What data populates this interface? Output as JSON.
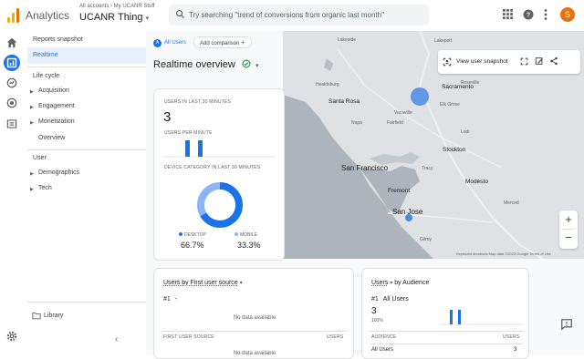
{
  "app": {
    "name": "Analytics"
  },
  "account": {
    "breadcrumb": "All accounts › My UCANR Stuff",
    "property": "UCANR Thing"
  },
  "search": {
    "placeholder": "Try searching \"trend of conversions from organic last month\""
  },
  "user": {
    "initial": "S"
  },
  "colors": {
    "accent": "#1a73e8",
    "avatar": "#e8710a",
    "logo_dark": "#e37400",
    "logo_light": "#f9ab00"
  },
  "nav": {
    "reports_snapshot": "Reports snapshot",
    "realtime": "Realtime",
    "life_cycle": "Life cycle",
    "acquisition": "Acquisition",
    "engagement": "Engagement",
    "monetization": "Monetization",
    "overview": "Overview",
    "user": "User",
    "demographics": "Demographics",
    "tech": "Tech",
    "library": "Library"
  },
  "toolbar": {
    "all_users": "All Users",
    "all_users_badge": "A",
    "add_comparison": "Add comparison"
  },
  "page": {
    "title": "Realtime overview"
  },
  "map": {
    "view_snapshot": "View user snapshot",
    "zoom_in": "+",
    "zoom_out": "−",
    "attribution": "Keyboard shortcuts   Map data ©2023 Google   Terms of Use",
    "cities": {
      "sacramento": "Sacramento",
      "santa_rosa": "Santa Rosa",
      "san_francisco": "San Francisco",
      "san_jose": "San Jose",
      "stockton": "Stockton",
      "modesto": "Modesto",
      "fremont": "Fremont",
      "vacaville": "Vacaville",
      "elk_grove": "Elk Grove",
      "healdsburg": "Healdsburg",
      "fairfield": "Fairfield",
      "napa": "Napa",
      "lodi": "Lodi",
      "roseville": "Roseville",
      "lakeport": "Lakeport",
      "lakeside": "Lakeside",
      "gilroy": "Gilroy",
      "tracy": "Tracy",
      "merced": "Merced"
    }
  },
  "users_card": {
    "title": "USERS IN LAST 30 MINUTES",
    "value": "3",
    "per_minute_label": "USERS PER MINUTE",
    "device_title": "DEVICE CATEGORY IN LAST 30 MINUTES",
    "desktop_label": "DESKTOP",
    "desktop_value": "66.7%",
    "desktop_fraction": 0.667,
    "mobile_label": "MOBILE",
    "mobile_value": "33.3%",
    "mobile_fraction": 0.333
  },
  "source_card": {
    "title": "Users by First user source",
    "rank": "#1",
    "rank_value": "-",
    "no_data": "No data available",
    "col_source": "FIRST USER SOURCE",
    "col_users": "USERS",
    "no_data_2": "No data available"
  },
  "audience_card": {
    "title_a": "Users",
    "title_b": "by Audience",
    "rank": "#1",
    "rank_name": "All Users",
    "value": "3",
    "percent": "100%",
    "col_audience": "AUDIENCE",
    "col_users": "USERS",
    "row_name": "All Users",
    "row_value": "3"
  }
}
